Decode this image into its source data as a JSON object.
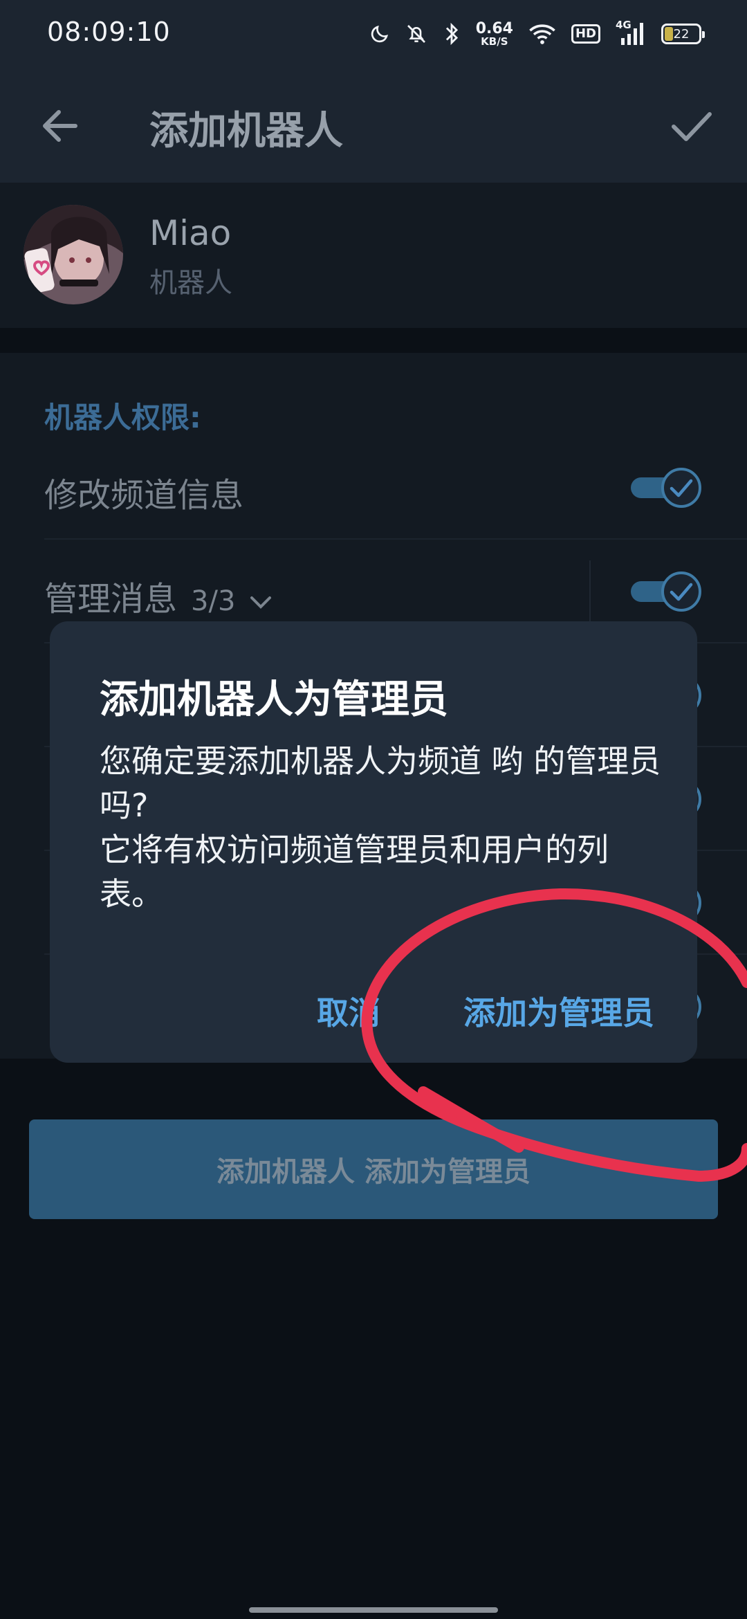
{
  "status_bar": {
    "time": "08:09:10",
    "net_speed_value": "0.64",
    "net_speed_unit": "KB/S",
    "hd_label": "HD",
    "network_type": "4G",
    "battery_level": "22",
    "icons": [
      "moon-icon",
      "bell-off-icon",
      "bluetooth-icon",
      "wifi-icon",
      "signal-icon",
      "battery-icon"
    ]
  },
  "app_bar": {
    "title": "添加机器人"
  },
  "bot": {
    "name": "Miao",
    "subtitle": "机器人"
  },
  "permissions": {
    "header": "机器人权限:",
    "items": [
      {
        "label": "修改频道信息",
        "enabled": true
      },
      {
        "label": "管理消息",
        "count": "3/3",
        "enabled": true
      }
    ]
  },
  "dialog": {
    "title": "添加机器人为管理员",
    "body_line1": "您确定要添加机器人为频道 哟 的管理员吗?",
    "body_line2": "它将有权访问频道管理员和用户的列表。",
    "cancel_label": "取消",
    "confirm_label": "添加为管理员"
  },
  "footer_button": {
    "label": "添加机器人 添加为管理员"
  },
  "colors": {
    "accent": "#58a7e6",
    "annotation": "#e8324e",
    "dialog_bg": "#222d3b"
  }
}
